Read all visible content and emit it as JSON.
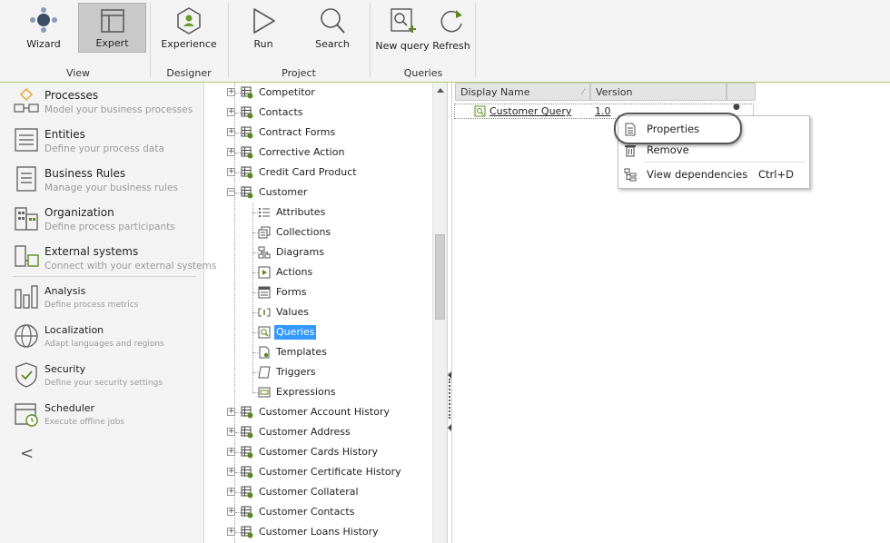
{
  "ribbon": {
    "groups": [
      {
        "label": "View",
        "buttons": [
          {
            "label": "Wizard",
            "icon": "wizard-icon"
          },
          {
            "label": "Expert",
            "icon": "expert-icon",
            "active": true
          }
        ]
      },
      {
        "label": "Designer",
        "buttons": [
          {
            "label": "Experience",
            "icon": "experience-icon"
          }
        ]
      },
      {
        "label": "Project",
        "buttons": [
          {
            "label": "Run",
            "icon": "run-icon"
          },
          {
            "label": "Search",
            "icon": "search-icon"
          }
        ]
      },
      {
        "label": "Queries",
        "buttons": [
          {
            "label": "New query",
            "icon": "new-query-icon"
          },
          {
            "label": "Refresh",
            "icon": "refresh-icon"
          }
        ]
      }
    ]
  },
  "leftnav": {
    "items": [
      {
        "title": "Processes",
        "subtitle": "Model your business processes",
        "icon": "processes-icon"
      },
      {
        "title": "Entities",
        "subtitle": "Define your process data",
        "icon": "entities-icon"
      },
      {
        "title": "Business Rules",
        "subtitle": "Manage your business rules",
        "icon": "business-rules-icon"
      },
      {
        "title": "Organization",
        "subtitle": "Define process participants",
        "icon": "organization-icon"
      },
      {
        "title": "External systems",
        "subtitle": "Connect with your external systems",
        "icon": "external-systems-icon"
      },
      {
        "title": "Analysis",
        "subtitle": "Define process metrics",
        "icon": "analysis-icon"
      },
      {
        "title": "Localization",
        "subtitle": "Adapt languages and regions",
        "icon": "localization-icon"
      },
      {
        "title": "Security",
        "subtitle": "Define your security settings",
        "icon": "security-icon"
      },
      {
        "title": "Scheduler",
        "subtitle": "Execute offline jobs",
        "icon": "scheduler-icon"
      }
    ],
    "collapse_label": "<"
  },
  "tree": {
    "top_items": [
      "Competitor",
      "Contacts",
      "Contract Forms",
      "Corrective Action",
      "Credit Card Product"
    ],
    "expanded": {
      "label": "Customer",
      "children": [
        {
          "label": "Attributes",
          "icon": "attributes-icon"
        },
        {
          "label": "Collections",
          "icon": "collections-icon"
        },
        {
          "label": "Diagrams",
          "icon": "diagrams-icon"
        },
        {
          "label": "Actions",
          "icon": "actions-icon"
        },
        {
          "label": "Forms",
          "icon": "forms-icon"
        },
        {
          "label": "Values",
          "icon": "values-icon"
        },
        {
          "label": "Queries",
          "icon": "queries-icon",
          "selected": true
        },
        {
          "label": "Templates",
          "icon": "templates-icon"
        },
        {
          "label": "Triggers",
          "icon": "triggers-icon"
        },
        {
          "label": "Expressions",
          "icon": "expressions-icon"
        }
      ]
    },
    "bottom_items": [
      "Customer Account History",
      "Customer Address",
      "Customer Cards History",
      "Customer Certificate History",
      "Customer Collateral",
      "Customer Contacts",
      "Customer Loans History"
    ],
    "expand_glyph": "+",
    "collapse_glyph": "−"
  },
  "grid": {
    "columns": [
      {
        "label": "Display Name"
      },
      {
        "label": "Version"
      }
    ],
    "sort_glyph": "⁄",
    "rows": [
      {
        "display_name": "Customer Query",
        "version": "1.0"
      }
    ]
  },
  "context_menu": {
    "items": [
      {
        "label": "Properties",
        "icon": "properties-icon",
        "shortcut": ""
      },
      {
        "label": "Remove",
        "icon": "trash-icon",
        "shortcut": ""
      },
      {
        "label": "View dependencies",
        "icon": "dependencies-icon",
        "shortcut": "Ctrl+D"
      }
    ]
  },
  "colors": {
    "accent_green": "#b3cc73",
    "selection_blue": "#3399ff",
    "entity_icon_green": "#5a8a1e",
    "ribbon_bg": "#f3f3f3"
  }
}
